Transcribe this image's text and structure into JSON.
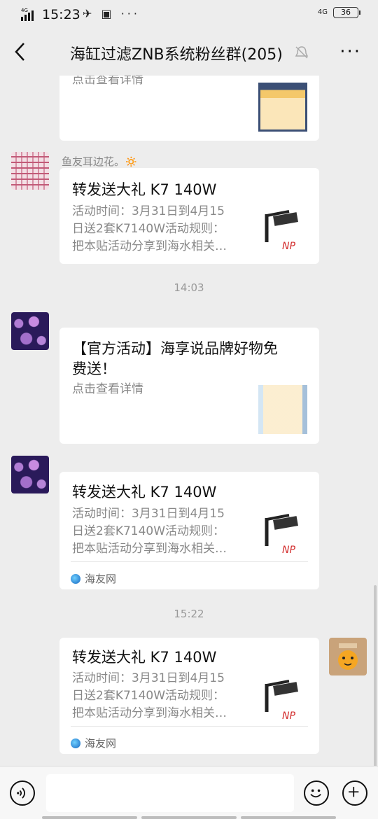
{
  "status_bar": {
    "network": "4G",
    "time": "15:23",
    "right_network": "4G",
    "battery": "36"
  },
  "header": {
    "title": "海缸过滤ZNB系统粉丝群(205)",
    "more": "···"
  },
  "messages": [
    {
      "type": "card_partial",
      "desc": "点击查看详情"
    },
    {
      "sender": "鱼友耳边花。🔅",
      "title": "转发送大礼 K7 140W",
      "desc": "活动时间：3月31日到4月15日送2套K7140W活动规则：把本贴活动分享到海水相关…"
    },
    {
      "timestamp": "14:03"
    },
    {
      "title": "【官方活动】海享说品牌好物免费送！",
      "desc": "点击查看详情"
    },
    {
      "title": "转发送大礼 K7 140W",
      "desc": "活动时间：3月31日到4月15日送2套K7140W活动规则：把本贴活动分享到海水相关…",
      "source": "海友网"
    },
    {
      "timestamp": "15:22"
    },
    {
      "title": "转发送大礼 K7 140W",
      "desc": "活动时间：3月31日到4月15日送2套K7140W活动规则：把本贴活动分享到海水相关…",
      "source": "海友网"
    }
  ],
  "desc_lines": [
    "活动时间：3月31日到4月15",
    "日送2套K7140W活动规则：",
    "把本贴活动分享到海水相关…"
  ],
  "title_lines_official": [
    "【官方活动】海享说品牌好物免",
    "费送！"
  ],
  "colors": {
    "background": "#ededed",
    "card": "#ffffff",
    "muted_text": "#888888"
  }
}
